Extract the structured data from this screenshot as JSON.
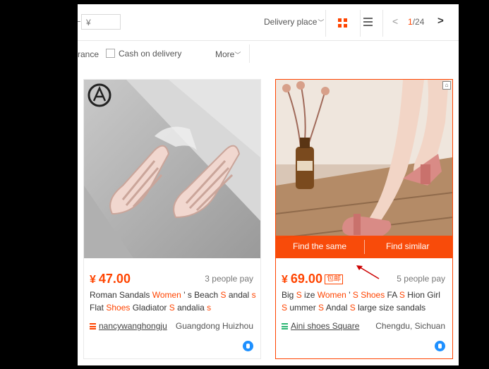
{
  "toolbar": {
    "price_placeholder": "¥",
    "delivery_label": "Delivery place",
    "pager_current": "1",
    "pager_total": "/24"
  },
  "filters": {
    "insurance_label": "rance",
    "cod_label": "Cash on delivery",
    "more_label": "More"
  },
  "products": [
    {
      "price_symbol": "¥",
      "price": "47.00",
      "pay_count": "3 people pay",
      "title_parts": [
        "Roman Sandals ",
        "Women",
        " ' s Beach ",
        "S",
        " andal ",
        "s",
        " Flat ",
        "Shoes",
        " Gladiator ",
        "S",
        " andalia ",
        "s"
      ],
      "shop": "nancywanghongju",
      "location": "Guangdong Huizhou"
    },
    {
      "price_symbol": "¥",
      "price": "69.00",
      "badge": "包邮",
      "pay_count": "5 people pay",
      "title_parts": [
        "Big ",
        "S",
        " ize ",
        "Women",
        " ' ",
        "S",
        " ",
        "Shoes",
        " FA ",
        "S",
        " Hion Girl ",
        "S",
        " ummer ",
        "S",
        " Andal ",
        "S",
        " large size sandals"
      ],
      "shop": "Aini shoes Square",
      "location": "Chengdu, Sichuan",
      "find_same": "Find the same",
      "find_similar": "Find similar"
    }
  ],
  "colors": {
    "accent": "#ff4400",
    "text": "#333333",
    "muted": "#777777"
  }
}
